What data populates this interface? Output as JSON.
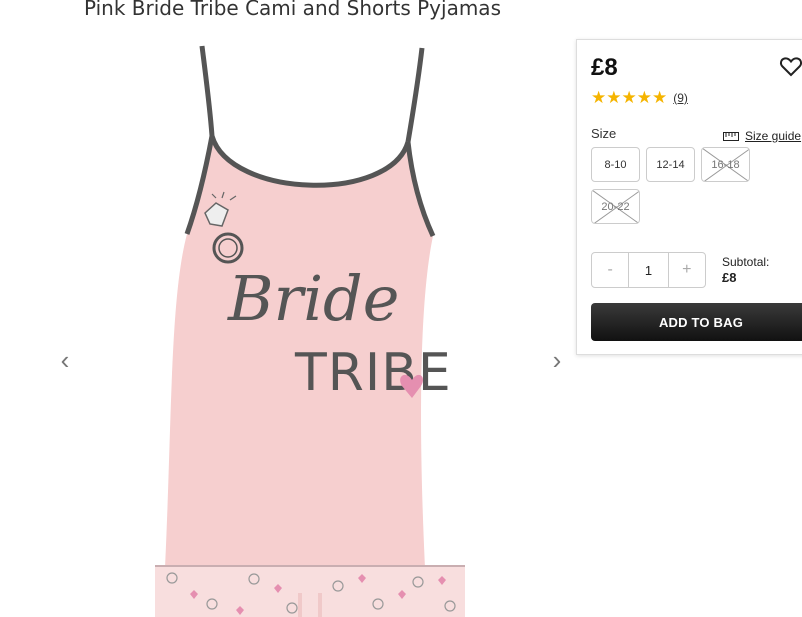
{
  "product": {
    "title": "Pink Bride Tribe Cami and Shorts Pyjamas",
    "print_line1": "Bride",
    "print_line2": "TRIBE"
  },
  "gallery": {
    "prev_glyph": "‹",
    "next_glyph": "›"
  },
  "purchase": {
    "price": "£8",
    "rating": 5,
    "review_count": "(9)",
    "size_label": "Size",
    "size_guide_label": "Size guide",
    "sizes": [
      {
        "label": "8-10",
        "available": true
      },
      {
        "label": "12-14",
        "available": true
      },
      {
        "label": "16-18",
        "available": false
      },
      {
        "label": "20-22",
        "available": false
      }
    ],
    "quantity": "1",
    "minus": "-",
    "plus": "+",
    "subtotal_label": "Subtotal:",
    "subtotal_value": "£8",
    "add_to_bag": "ADD TO BAG"
  },
  "icons": {
    "wishlist": "heart-outline-icon",
    "star": "star-icon",
    "size_guide": "ruler-icon"
  },
  "colors": {
    "star": "#f5b400",
    "button": "#1a1a1a",
    "cami": "#f6cfcf",
    "print": "#555555"
  }
}
